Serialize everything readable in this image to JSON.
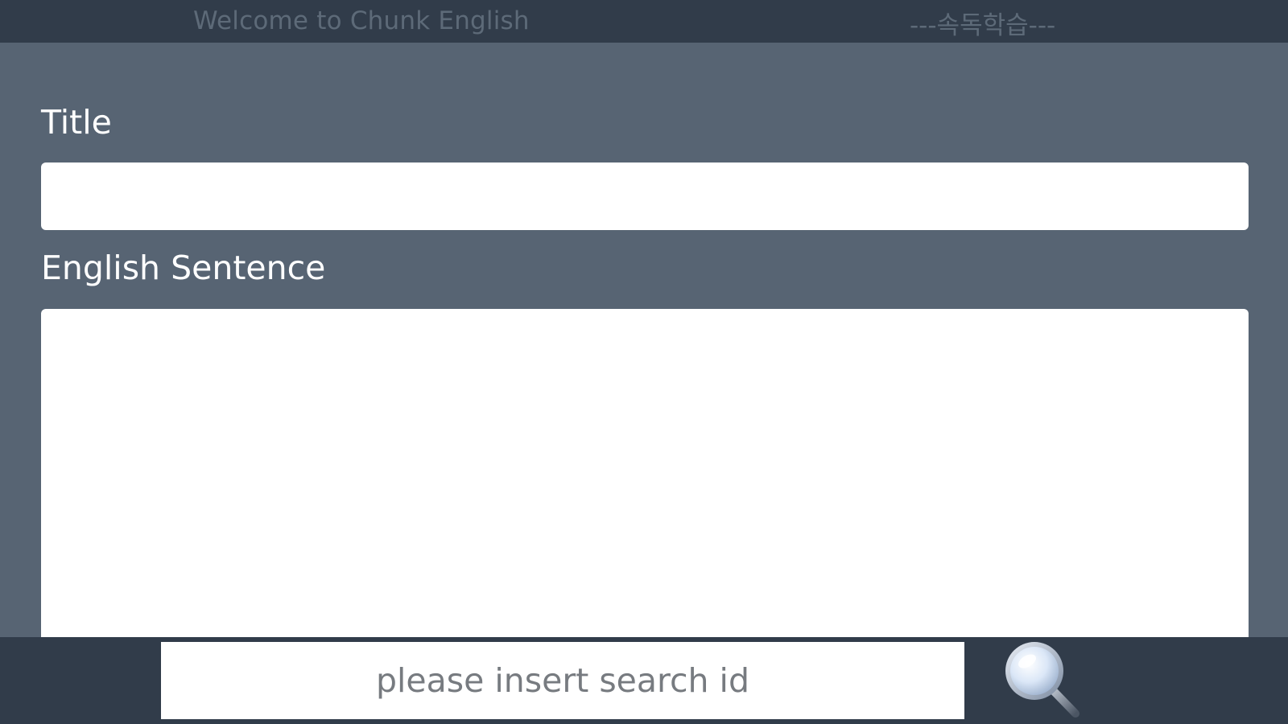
{
  "header": {
    "welcome_text": "Welcome to Chunk English",
    "mode_text": "---속독학습---"
  },
  "form": {
    "title_label": "Title",
    "title_value": "",
    "sentence_label": "English Sentence",
    "sentence_value": ""
  },
  "search": {
    "placeholder": "please insert search id",
    "value": "",
    "icon": "search-icon"
  },
  "colors": {
    "background": "#576473",
    "bar": "#313c4a",
    "header_text": "#5d6a78",
    "label_text": "#ffffff"
  }
}
